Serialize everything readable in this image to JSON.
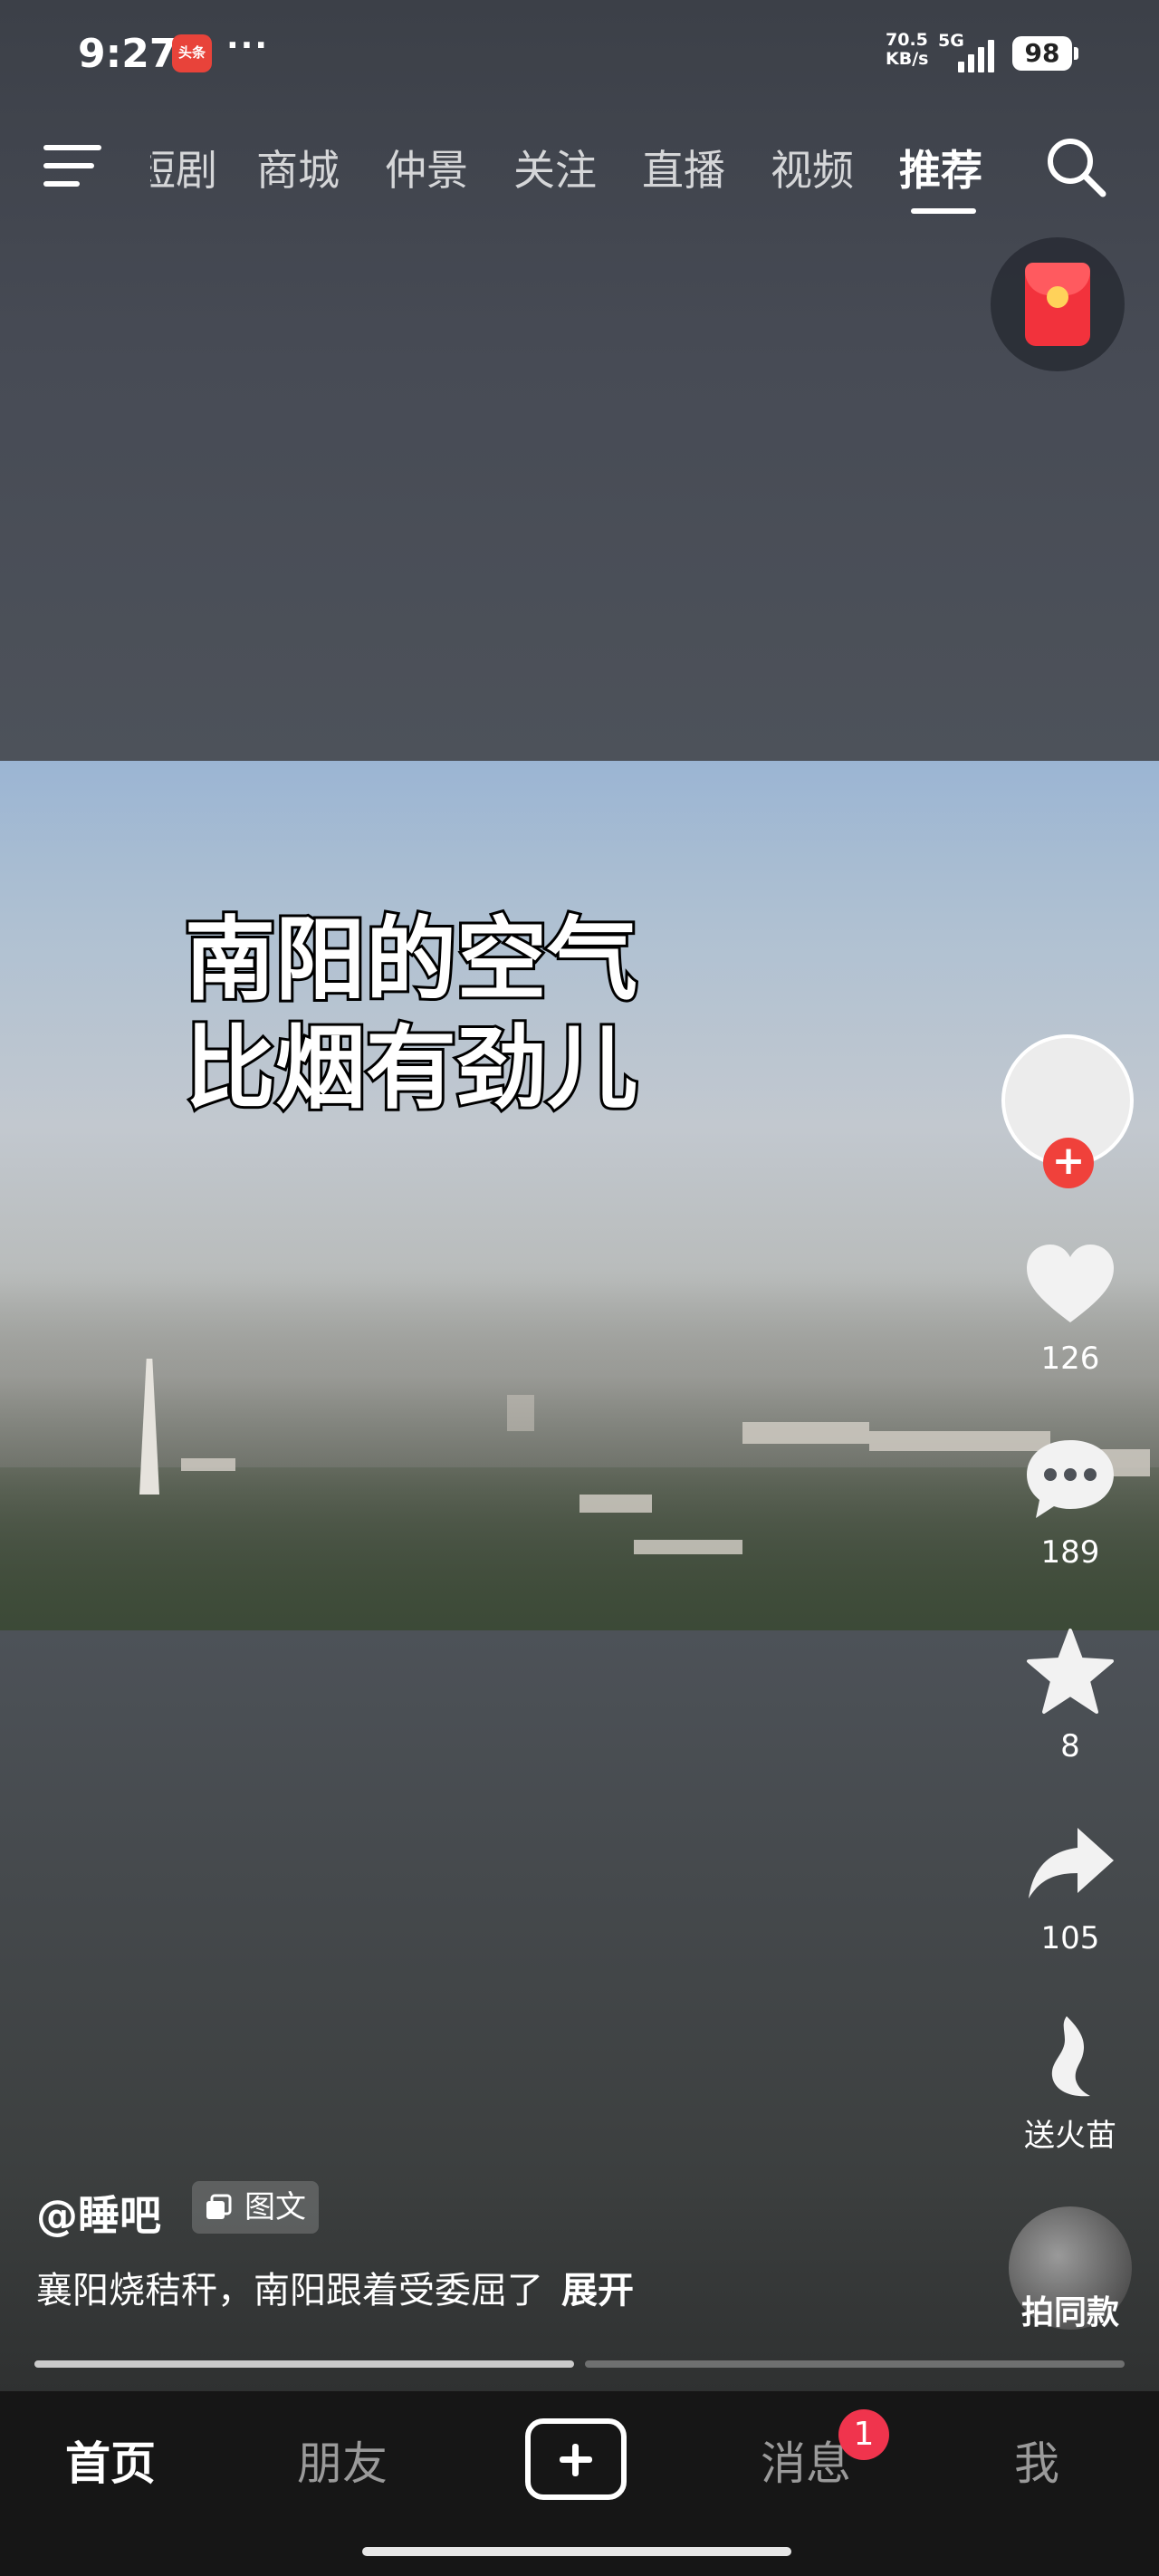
{
  "status_bar": {
    "time": "9:27",
    "app_badge": "头条",
    "more": "···",
    "net_speed_value": "70.5",
    "net_speed_unit": "KB/s",
    "network": "5G",
    "battery": "98"
  },
  "top_nav": {
    "tabs": [
      {
        "label": "短剧"
      },
      {
        "label": "商城"
      },
      {
        "label": "仲景"
      },
      {
        "label": "关注"
      },
      {
        "label": "直播"
      },
      {
        "label": "视频"
      },
      {
        "label": "推荐"
      }
    ],
    "active_tab": "推荐"
  },
  "video": {
    "caption_text": "南阳的空气\n比烟有劲儿",
    "author": "@睡吧",
    "tag": "图文",
    "description": "襄阳烧秸秆，南阳跟着受委屈了",
    "expand": "展开",
    "progress": 0.5
  },
  "right_rail": {
    "likes": "126",
    "comments": "189",
    "favorites": "8",
    "shares": "105",
    "gift_label": "送火苗",
    "same_style_label": "拍同款"
  },
  "bottom_nav": {
    "items": [
      {
        "label": "首页"
      },
      {
        "label": "朋友"
      },
      {
        "label": "消息"
      },
      {
        "label": "我"
      }
    ],
    "message_badge": "1"
  },
  "colors": {
    "accent_red": "#f0413b",
    "badge_red": "#f0344d",
    "nav_background": "#161616"
  }
}
